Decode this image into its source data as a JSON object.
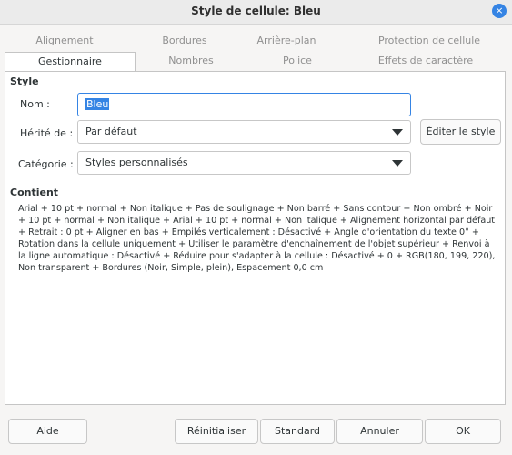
{
  "window": {
    "title": "Style de cellule: Bleu",
    "close_glyph": "×"
  },
  "tabs_row1": [
    "Alignement",
    "Bordures",
    "Arrière-plan",
    "Protection de cellule"
  ],
  "tabs_row2": [
    "Gestionnaire",
    "Nombres",
    "Police",
    "Effets de caractère"
  ],
  "active_tab": "Gestionnaire",
  "style_section": {
    "title": "Style",
    "name_label": "Nom :",
    "name_value": "Bleu",
    "inherit_label": "Hérité de :",
    "inherit_value": "Par défaut",
    "edit_style_button": "Éditer le style",
    "category_label": "Catégorie :",
    "category_value": "Styles personnalisés"
  },
  "contents_section": {
    "title": "Contient",
    "text": "Arial + 10 pt + normal + Non italique + Pas de soulignage + Non barré + Sans contour + Non ombré + Noir + 10 pt + normal + Non italique + Arial + 10 pt + normal + Non italique + Alignement horizontal par défaut + Retrait : 0 pt + Aligner en bas + Empilés verticalement : Désactivé + Angle d'orientation du texte 0° + Rotation dans la cellule uniquement + Utiliser le paramètre d'enchaînement de l'objet supérieur + Renvoi à la ligne automatique : Désactivé + Réduire pour s'adapter à la cellule : Désactivé + 0 + RGB(180, 199, 220), Non transparent + Bordures (Noir, Simple, plein), Espacement 0,0 cm"
  },
  "footer": {
    "help": "Aide",
    "reset": "Réinitialiser",
    "standard": "Standard",
    "cancel": "Annuler",
    "ok": "OK"
  },
  "colors": {
    "accent": "#3584e4",
    "background": "#f6f5f4",
    "panel": "#ffffff"
  }
}
